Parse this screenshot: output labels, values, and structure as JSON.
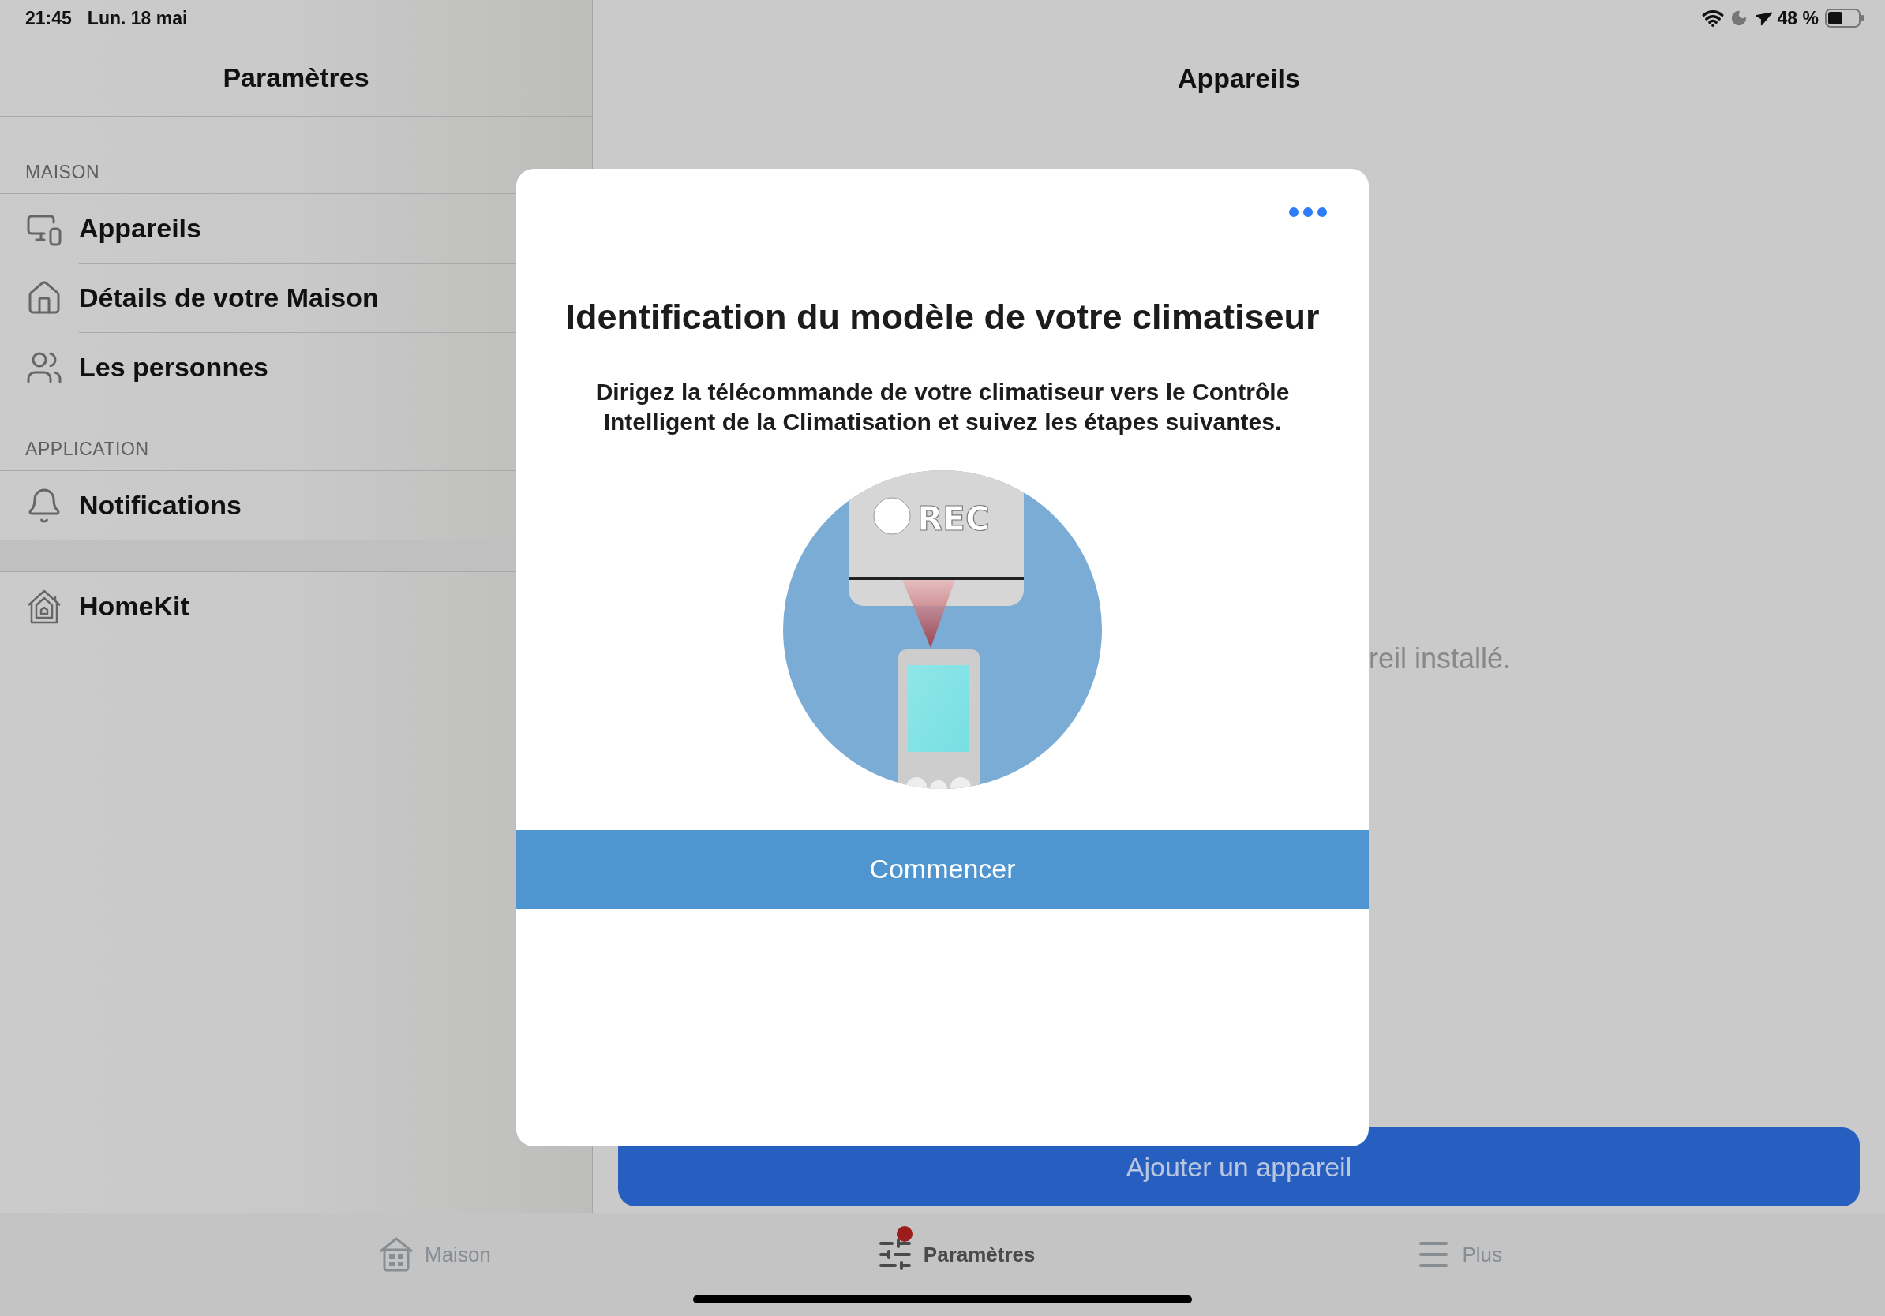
{
  "status_bar": {
    "time": "21:45",
    "date": "Lun. 18 mai",
    "battery": "48 %"
  },
  "sidebar": {
    "title": "Paramètres",
    "sections": [
      {
        "header": "MAISON",
        "items": [
          {
            "label": "Appareils"
          },
          {
            "label": "Détails de votre Maison"
          },
          {
            "label": "Les personnes"
          }
        ]
      },
      {
        "header": "APPLICATION",
        "items": [
          {
            "label": "Notifications"
          }
        ]
      },
      {
        "items": [
          {
            "label": "HomeKit"
          }
        ]
      }
    ]
  },
  "main": {
    "title": "Appareils",
    "empty_text": "reil installé.",
    "add_button": "Ajouter un appareil"
  },
  "dialog": {
    "title": "Identification du modèle de votre climatiseur",
    "message": "Dirigez la télécommande de votre climatiseur vers le Contrôle Intelligent de la Climatisation et suivez les étapes suivantes.",
    "illustration_label": "REC",
    "start_button": "Commencer"
  },
  "tab_bar": {
    "tabs": [
      {
        "label": "Maison",
        "selected": false,
        "badge": false
      },
      {
        "label": "Paramètres",
        "selected": true,
        "badge": true
      },
      {
        "label": "Plus",
        "selected": false,
        "badge": false
      }
    ]
  }
}
